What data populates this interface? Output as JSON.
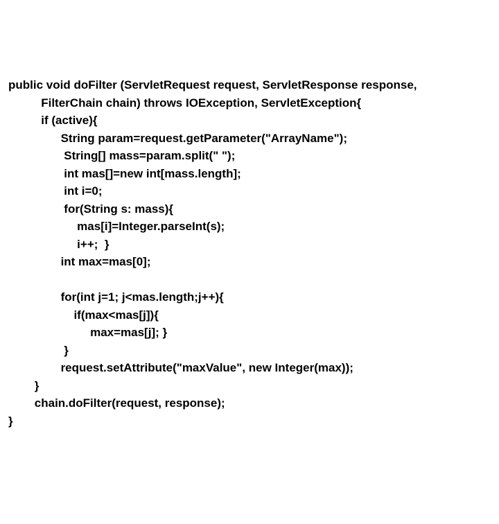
{
  "code": {
    "lines": [
      "public void doFilter (ServletRequest request, ServletResponse response,",
      "          FilterChain chain) throws IOException, ServletException{",
      "          if (active){",
      "                String param=request.getParameter(\"ArrayName\");",
      "                 String[] mass=param.split(\" \");",
      "                 int mas[]=new int[mass.length];",
      "                 int i=0;",
      "                 for(String s: mass){",
      "                     mas[i]=Integer.parseInt(s);",
      "                     i++;  }",
      "                int max=mas[0];",
      "",
      "                for(int j=1; j<mas.length;j++){",
      "                    if(max<mas[j]){",
      "                         max=mas[j]; }",
      "                 }",
      "                request.setAttribute(\"maxValue\", new Integer(max));",
      "        }",
      "        chain.doFilter(request, response);",
      "}"
    ]
  }
}
